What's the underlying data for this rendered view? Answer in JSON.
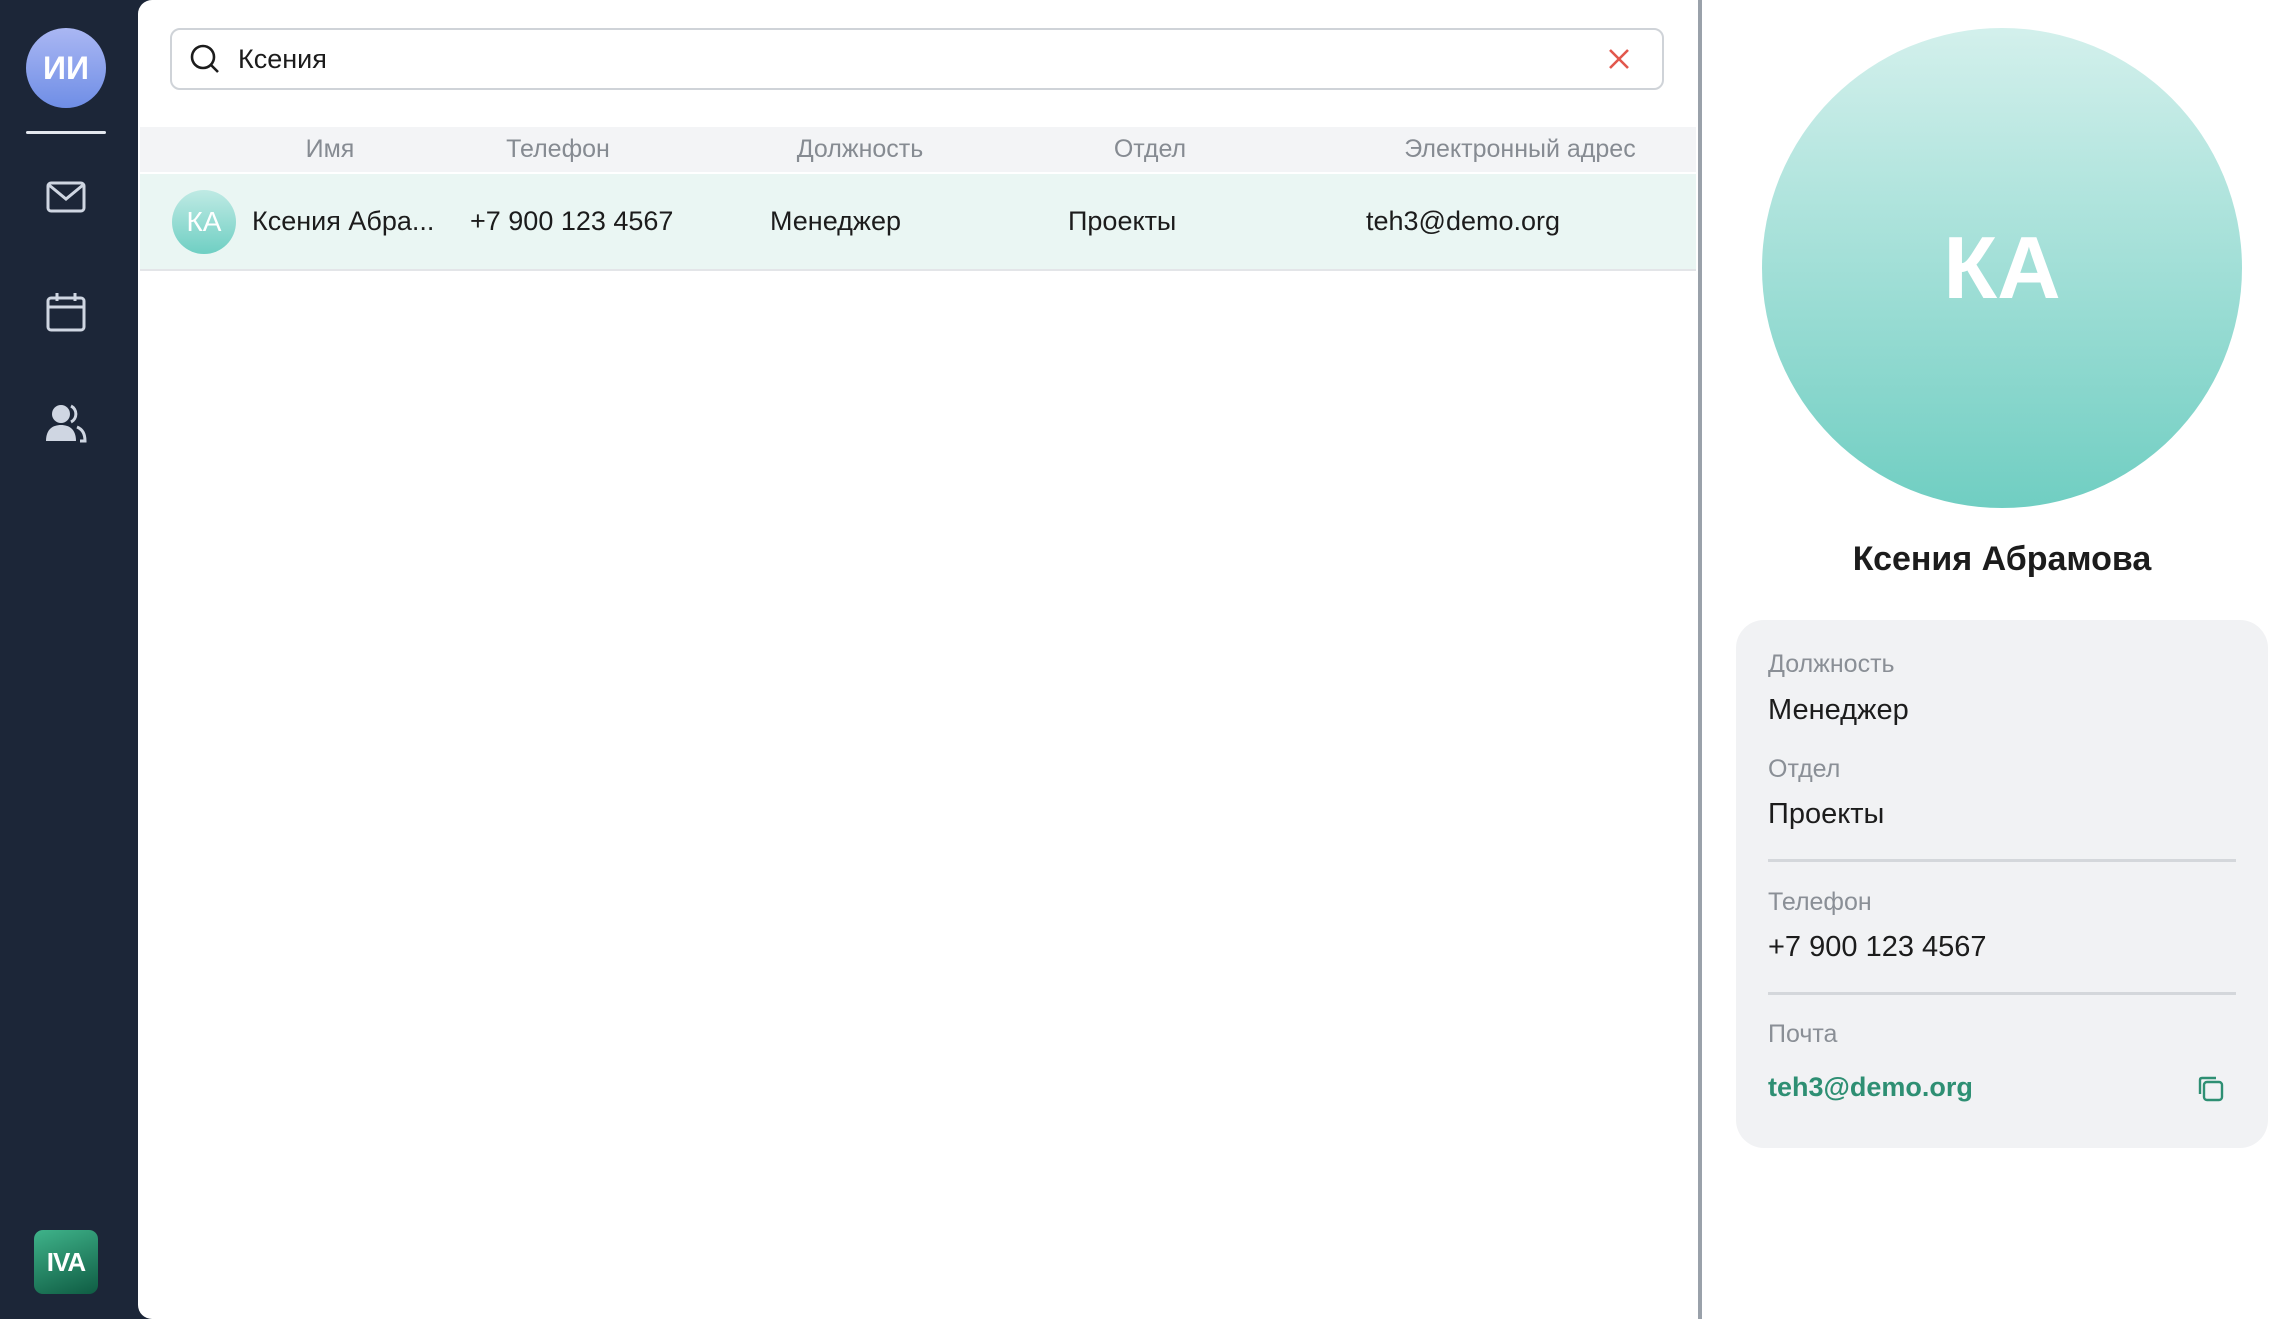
{
  "sidebar": {
    "user_initials": "ИИ",
    "logo_text": "IVA",
    "icons": [
      "mail-icon",
      "calendar-icon",
      "contacts-icon"
    ]
  },
  "search": {
    "value": "Ксения",
    "icon": "search-icon",
    "clear_icon": "close-icon"
  },
  "table": {
    "columns": [
      "Имя",
      "Телефон",
      "Должность",
      "Отдел",
      "Электронный адрес"
    ],
    "rows": [
      {
        "initials": "КА",
        "name": "Ксения Абра...",
        "phone": "+7 900 123 4567",
        "position": "Менеджер",
        "department": "Проекты",
        "email": "teh3@demo.org"
      }
    ]
  },
  "profile": {
    "initials": "КА",
    "name": "Ксения Абрамова",
    "position_label": "Должность",
    "position": "Менеджер",
    "department_label": "Отдел",
    "department": "Проекты",
    "phone_label": "Телефон",
    "phone": "+7 900 123 4567",
    "email_label": "Почта",
    "email": "teh3@demo.org"
  },
  "colors": {
    "sidebar_bg": "#1c2638",
    "accent": "#2e8f73",
    "row_highlight": "#eaf6f3",
    "clear_icon": "#e2574c"
  }
}
